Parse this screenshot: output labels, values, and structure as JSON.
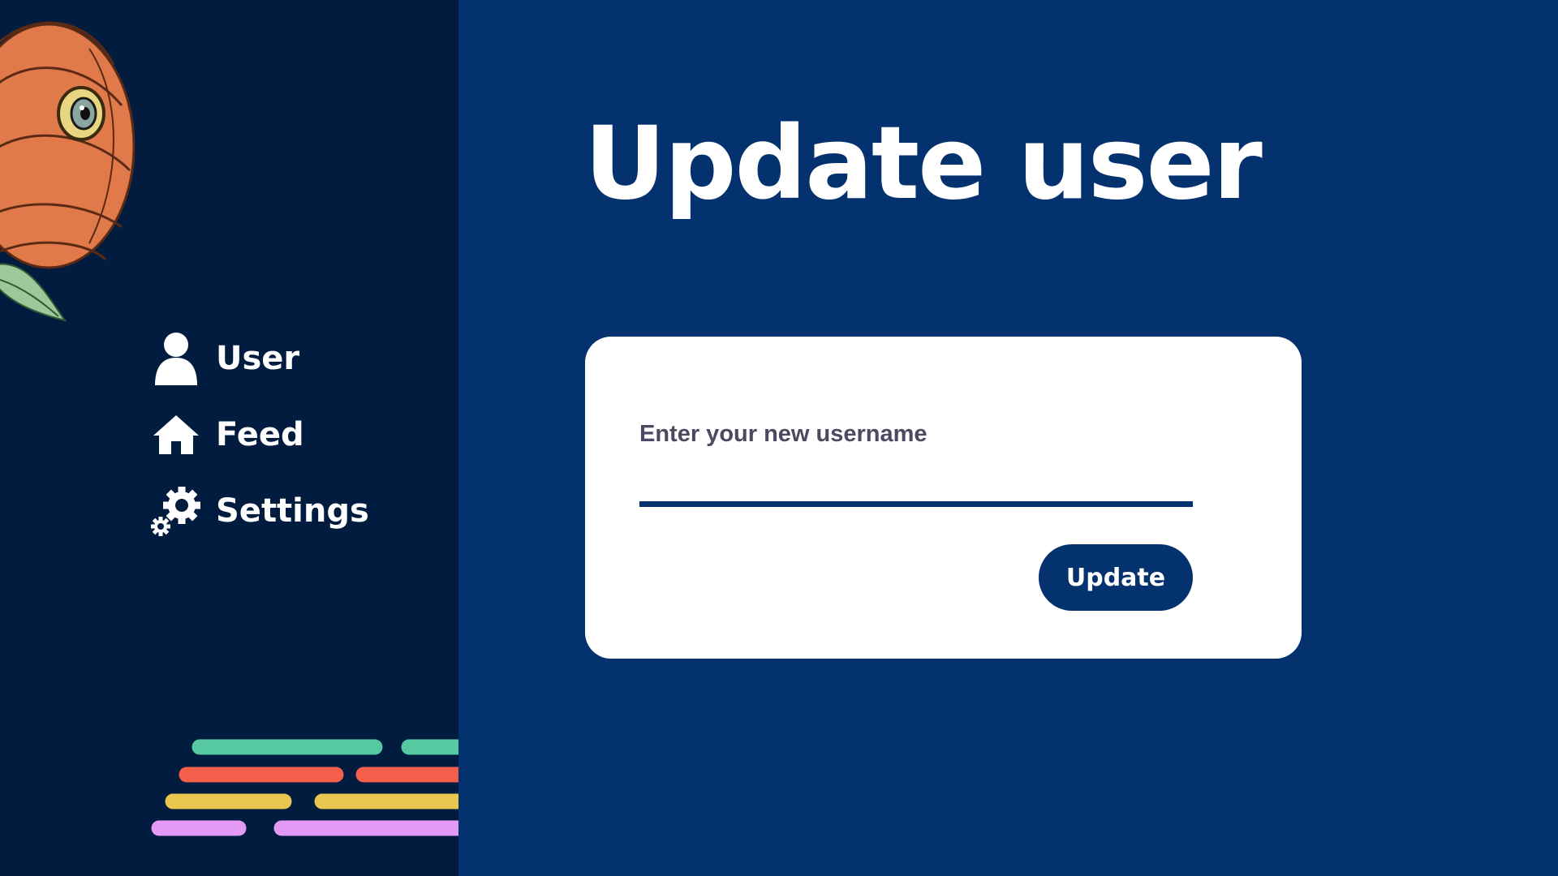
{
  "page": {
    "title": "Update user"
  },
  "sidebar": {
    "items": [
      {
        "label": "User",
        "icon": "user-icon"
      },
      {
        "label": "Feed",
        "icon": "home-icon"
      },
      {
        "label": "Settings",
        "icon": "gear-icon"
      }
    ],
    "decoration": {
      "illustration": "rose-illustration",
      "stripe_colors": [
        "#56c9a0",
        "#f45f4c",
        "#e8c64f",
        "#e49af5"
      ]
    }
  },
  "form": {
    "label": "Enter your new username",
    "input_value": "",
    "button_label": "Update"
  },
  "colors": {
    "sidebar_bg": "#021c3f",
    "main_bg": "#04326e",
    "card_bg": "#ffffff",
    "accent": "#04326e"
  }
}
